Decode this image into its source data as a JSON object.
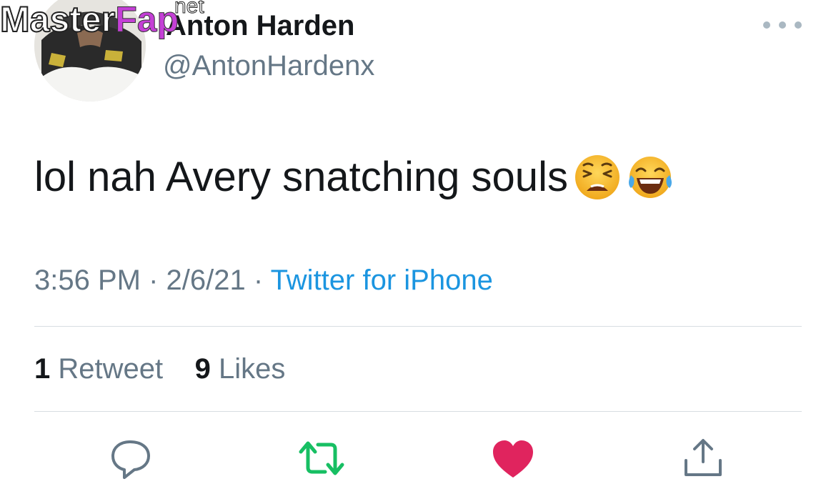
{
  "tweet": {
    "display_name": "Anton Harden",
    "handle": "@AntonHardenx",
    "text": "lol nah Avery snatching souls",
    "emojis": [
      "weary-face-icon",
      "face-with-tears-of-joy-icon"
    ],
    "time": "3:56 PM",
    "separator": " · ",
    "date": "2/6/21",
    "source": "Twitter for iPhone",
    "retweets_count": "1",
    "retweets_label": "Retweet",
    "likes_count": "9",
    "likes_label": "Likes"
  },
  "watermark": {
    "master": "Master",
    "fap": "Fap",
    "net": "net"
  },
  "colors": {
    "text_primary": "#14171a",
    "text_secondary": "#657786",
    "link": "#1b95e0",
    "retweet_green": "#17bf63",
    "like_red": "#e0245e",
    "icon_gray": "#657786",
    "divider": "#d8dde1"
  },
  "actions": [
    "reply-icon",
    "retweet-icon",
    "like-icon",
    "share-icon"
  ]
}
